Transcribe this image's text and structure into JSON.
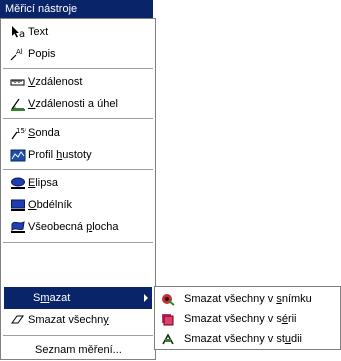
{
  "menubar": {
    "title": "Měřicí nástroje"
  },
  "menu": {
    "items": [
      {
        "label": "Text",
        "icon": "text-cursor-icon"
      },
      {
        "label": "Popis",
        "icon": "annotation-icon"
      },
      {
        "label": "Vzdálenost",
        "icon": "ruler-icon"
      },
      {
        "label": "Vzdálenosti a úhel",
        "icon": "angle-ruler-icon"
      },
      {
        "label": "Sonda",
        "icon": "probe-icon"
      },
      {
        "label": "Profil hustoty",
        "icon": "density-profile-icon"
      },
      {
        "label": "Elipsa",
        "icon": "ellipse-icon"
      },
      {
        "label": "Obdélník",
        "icon": "rectangle-icon"
      },
      {
        "label": "Všeobecná plocha",
        "icon": "freeform-area-icon"
      },
      {
        "label": "Smazat",
        "icon": ""
      },
      {
        "label": "Smazat všechny",
        "icon": "eraser-icon"
      },
      {
        "label": "Seznam měření...",
        "icon": ""
      }
    ]
  },
  "submenu": {
    "items": [
      {
        "label": "Smazat všechny v snímku",
        "icon": "delete-image-icon"
      },
      {
        "label": "Smazat všechny v sérii",
        "icon": "delete-series-icon"
      },
      {
        "label": "Smazat všechny v studii",
        "icon": "delete-study-icon"
      }
    ]
  },
  "colors": {
    "highlight": "#0a246a",
    "highlight_text": "#ffffff",
    "separator": "#a0a0a0"
  }
}
